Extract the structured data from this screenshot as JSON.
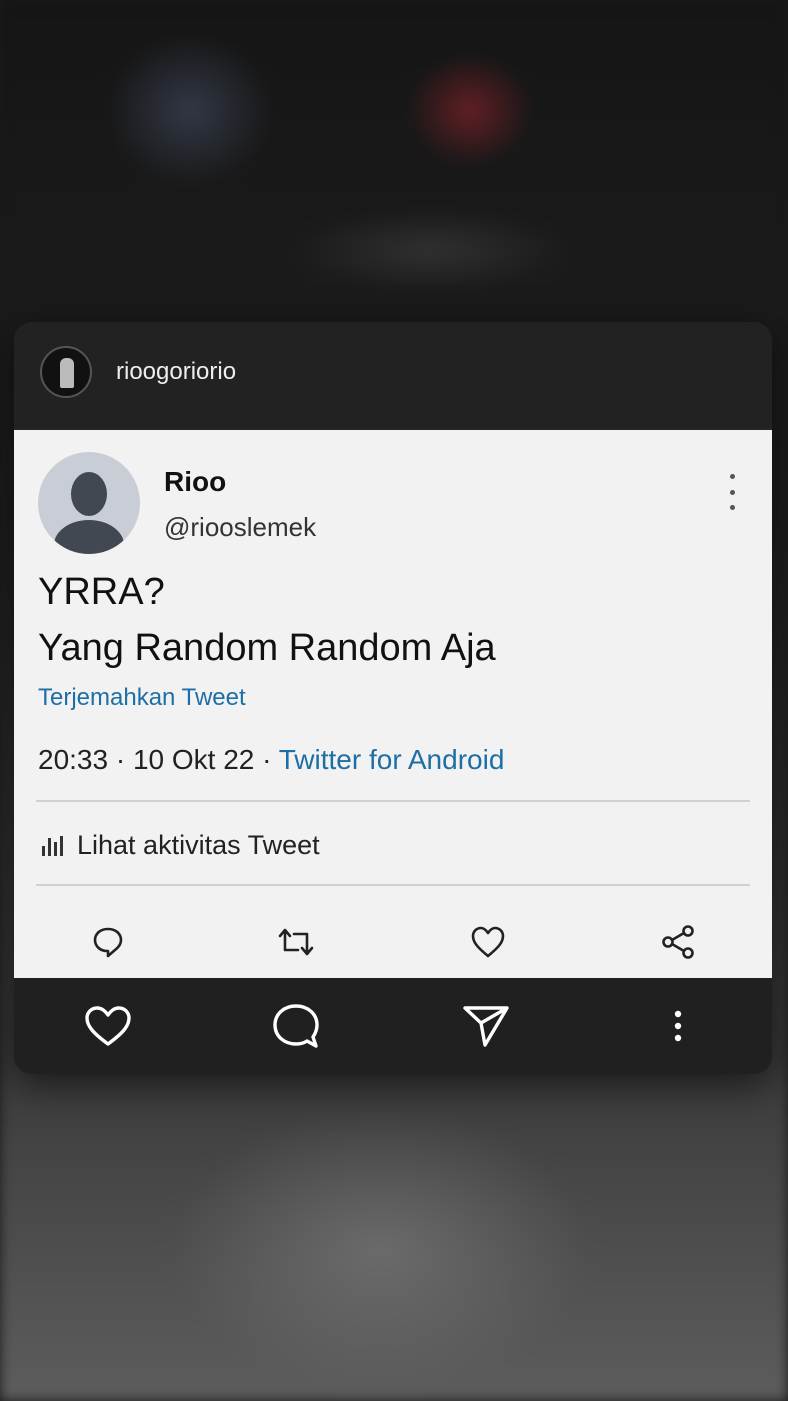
{
  "post": {
    "username": "rioogoriorio"
  },
  "tweet": {
    "display_name": "Rioo",
    "handle": "@riooslemek",
    "text_line1": "YRRA?",
    "text_line2": "Yang Random Random Aja",
    "translate_label": "Terjemahkan Tweet",
    "time_date": "20:33 · 10 Okt 22 · ",
    "source": "Twitter for Android",
    "activity_label": "Lihat aktivitas Tweet",
    "actions": [
      "reply-icon",
      "retweet-icon",
      "like-icon",
      "share-icon"
    ]
  },
  "post_actions": [
    "heart-icon",
    "comment-icon",
    "send-icon",
    "more-icon"
  ],
  "colors": {
    "link": "#1d6fa5",
    "tweet_bg": "#f2f2f2",
    "card_bg": "#262626"
  }
}
